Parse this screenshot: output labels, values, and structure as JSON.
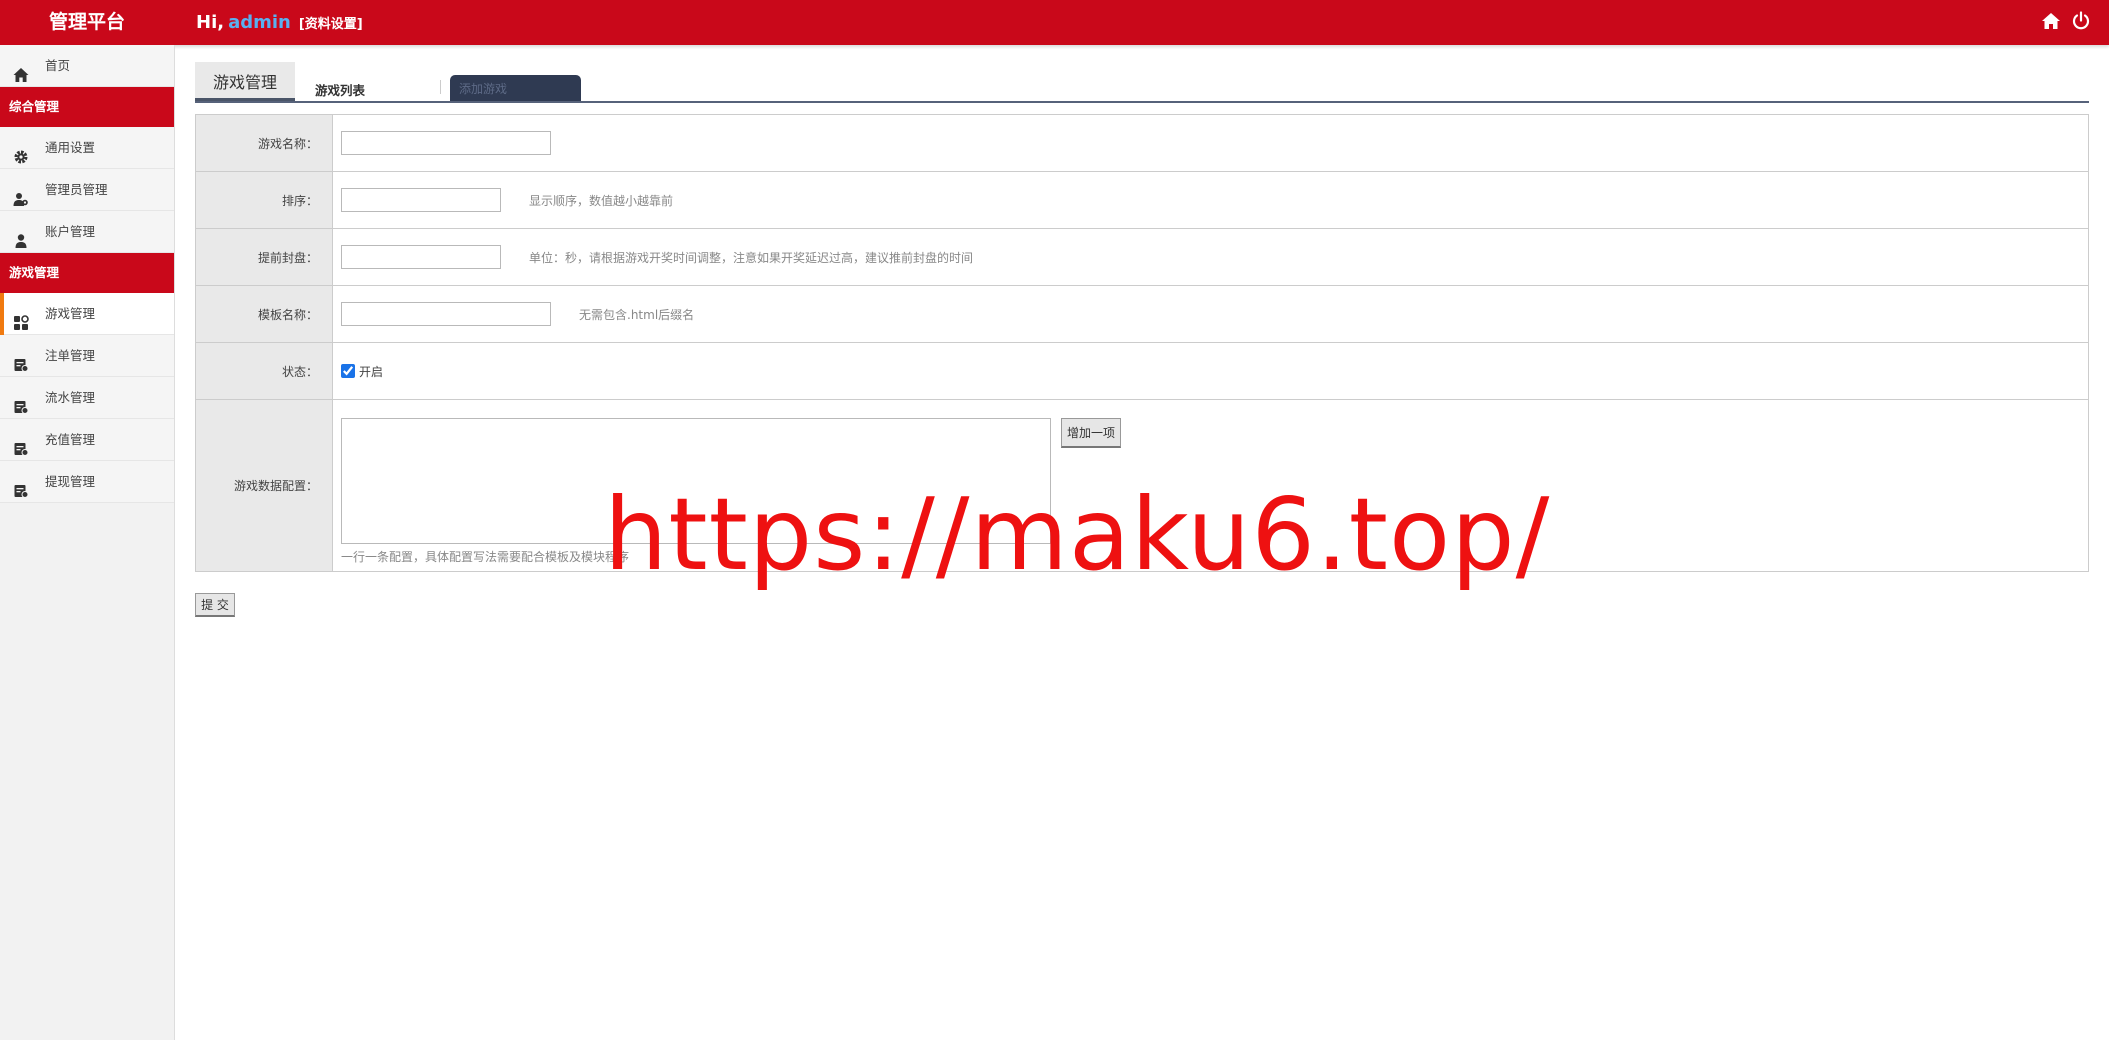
{
  "header": {
    "brand": "管理平台",
    "hi": "Hi,",
    "user": "admin",
    "profile_link": "[资料设置]",
    "accent": "#c9081a"
  },
  "sidebar": {
    "home": "首页",
    "section1": "综合管理",
    "section1_items": [
      "通用设置",
      "管理员管理",
      "账户管理"
    ],
    "section2": "游戏管理",
    "section2_items": [
      "游戏管理",
      "注单管理",
      "流水管理",
      "充值管理",
      "提现管理"
    ]
  },
  "tabs": {
    "title": "游戏管理",
    "list": "游戏列表",
    "add": "添加游戏"
  },
  "form": {
    "name_label": "游戏名称：",
    "name_value": "",
    "sort_label": "排序：",
    "sort_value": "",
    "sort_hint": "显示顺序，数值越小越靠前",
    "close_label": "提前封盘：",
    "close_value": "",
    "close_hint": "单位：秒，请根据游戏开奖时间调整，注意如果开奖延迟过高，建议推前封盘的时间",
    "tpl_label": "模板名称：",
    "tpl_value": "",
    "tpl_hint": "无需包含.html后缀名",
    "status_label": "状态：",
    "status_option": "开启",
    "status_checked": true,
    "data_label": "游戏数据配置：",
    "data_value": "",
    "add_btn": "增加一项",
    "data_hint": "一行一条配置，具体配置写法需要配合模板及模块程序"
  },
  "submit": "提 交",
  "watermark": "https://maku6.top/"
}
